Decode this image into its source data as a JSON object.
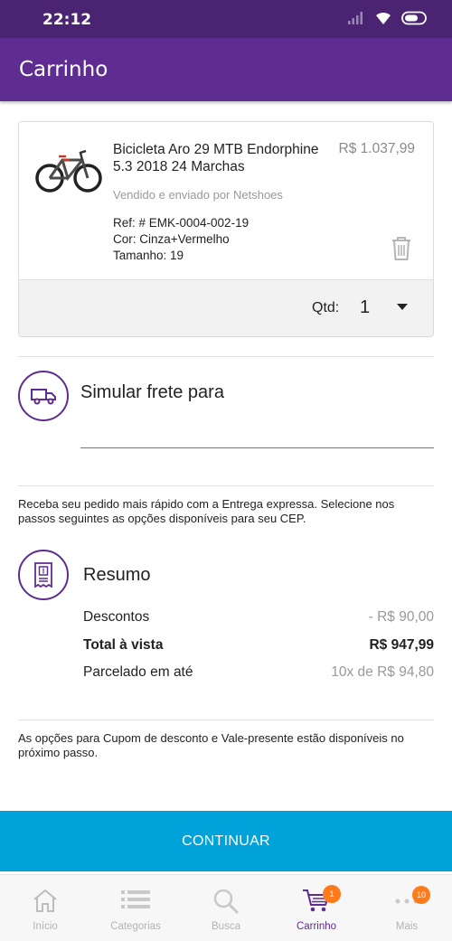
{
  "status_bar": {
    "time": "22:12"
  },
  "header": {
    "title": "Carrinho"
  },
  "cart_item": {
    "name": "Bicicleta Aro 29 MTB Endorphine 5.3 2018 24 Marchas",
    "price": "R$ 1.037,99",
    "seller": "Vendido e enviado por Netshoes",
    "ref": "Ref: # EMK-0004-002-19",
    "color": "Cor: Cinza+Vermelho",
    "size": "Tamanho: 19",
    "qty_label": "Qtd:",
    "qty_value": "1"
  },
  "shipping": {
    "title": "Simular frete para",
    "input_value": "",
    "note": "Receba seu pedido mais rápido com a Entrega expressa. Selecione nos passos seguintes as opções disponíveis para seu CEP."
  },
  "summary": {
    "title": "Resumo",
    "rows": [
      {
        "label": "Descontos",
        "value": "- R$ 90,00"
      },
      {
        "label": "Total à vista",
        "value": "R$ 947,99"
      },
      {
        "label": "Parcelado em até",
        "value": "10x de R$ 94,80"
      }
    ],
    "note": "As opções para Cupom de desconto e Vale-presente estão disponíveis no próximo passo."
  },
  "continue_button": {
    "label": "CONTINUAR"
  },
  "tab_bar": {
    "items": [
      {
        "label": "Início",
        "icon": "home-icon"
      },
      {
        "label": "Categorias",
        "icon": "list-icon"
      },
      {
        "label": "Busca",
        "icon": "search-icon"
      },
      {
        "label": "Carrinho",
        "icon": "cart-icon",
        "badge": "1",
        "active": true
      },
      {
        "label": "Mais",
        "icon": "more-icon",
        "badge": "10"
      }
    ]
  },
  "colors": {
    "primary": "#5f2d91",
    "status_bar": "#4a2472",
    "accent": "#00a2da",
    "badge": "#ff7a1a"
  }
}
